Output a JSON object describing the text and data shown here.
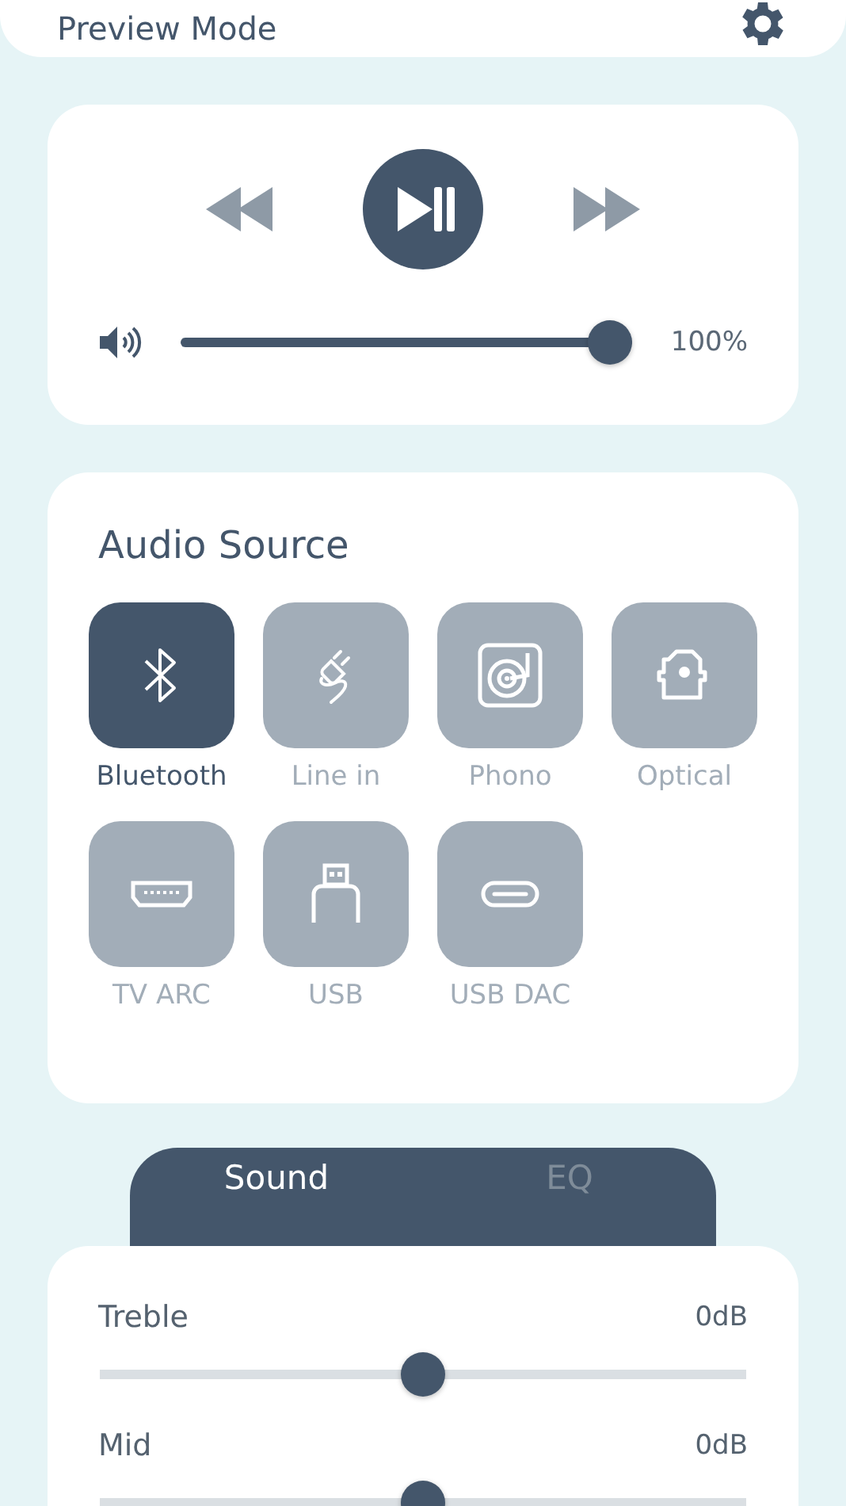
{
  "header": {
    "title": "Preview Mode"
  },
  "player": {
    "volume": {
      "level": 1.0,
      "reading": "100%"
    }
  },
  "audio_source": {
    "title": "Audio Source",
    "sources": [
      {
        "kind": "bluetooth",
        "label": "Bluetooth",
        "selected": true
      },
      {
        "kind": "line-in",
        "label": "Line in",
        "selected": false
      },
      {
        "kind": "phono",
        "label": "Phono",
        "selected": false
      },
      {
        "kind": "optical",
        "label": "Optical",
        "selected": false
      },
      {
        "kind": "tv-arc",
        "label": "TV ARC",
        "selected": false
      },
      {
        "kind": "usb",
        "label": "USB",
        "selected": false
      },
      {
        "kind": "usb-dac",
        "label": "USB DAC",
        "selected": false
      }
    ]
  },
  "tabs": [
    {
      "label": "Sound",
      "selected": true
    },
    {
      "label": "EQ",
      "selected": false
    }
  ],
  "sound": {
    "sliders": [
      {
        "name": "Treble",
        "reading": "0dB",
        "level": 0.5
      },
      {
        "name": "Mid",
        "reading": "0dB",
        "level": 0.5
      }
    ]
  }
}
